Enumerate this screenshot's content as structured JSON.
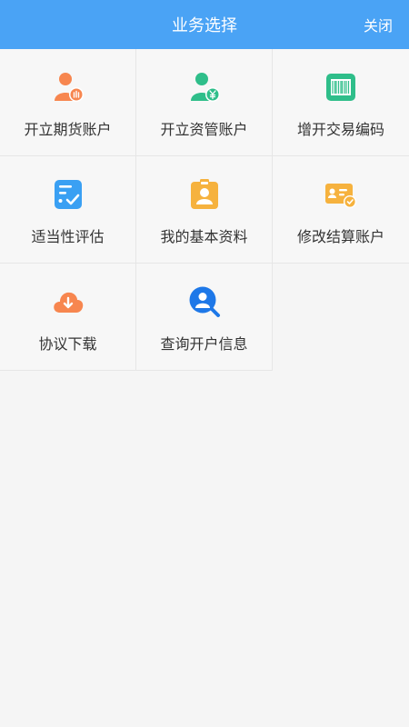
{
  "header": {
    "title": "业务选择",
    "close_label": "关闭"
  },
  "colors": {
    "header_bg": "#4aa3f5",
    "orange": "#f7864f",
    "green": "#2fbe8a",
    "blue": "#3aa0f3",
    "amber": "#f6b23e"
  },
  "menu": [
    {
      "label": "开立期货账户",
      "icon": "person-futures-icon"
    },
    {
      "label": "开立资管账户",
      "icon": "person-yuan-icon"
    },
    {
      "label": "增开交易编码",
      "icon": "barcode-icon"
    },
    {
      "label": "适当性评估",
      "icon": "checklist-icon"
    },
    {
      "label": "我的基本资料",
      "icon": "id-badge-icon"
    },
    {
      "label": "修改结算账户",
      "icon": "account-card-check-icon"
    },
    {
      "label": "协议下载",
      "icon": "cloud-download-icon"
    },
    {
      "label": "查询开户信息",
      "icon": "search-person-icon"
    }
  ]
}
